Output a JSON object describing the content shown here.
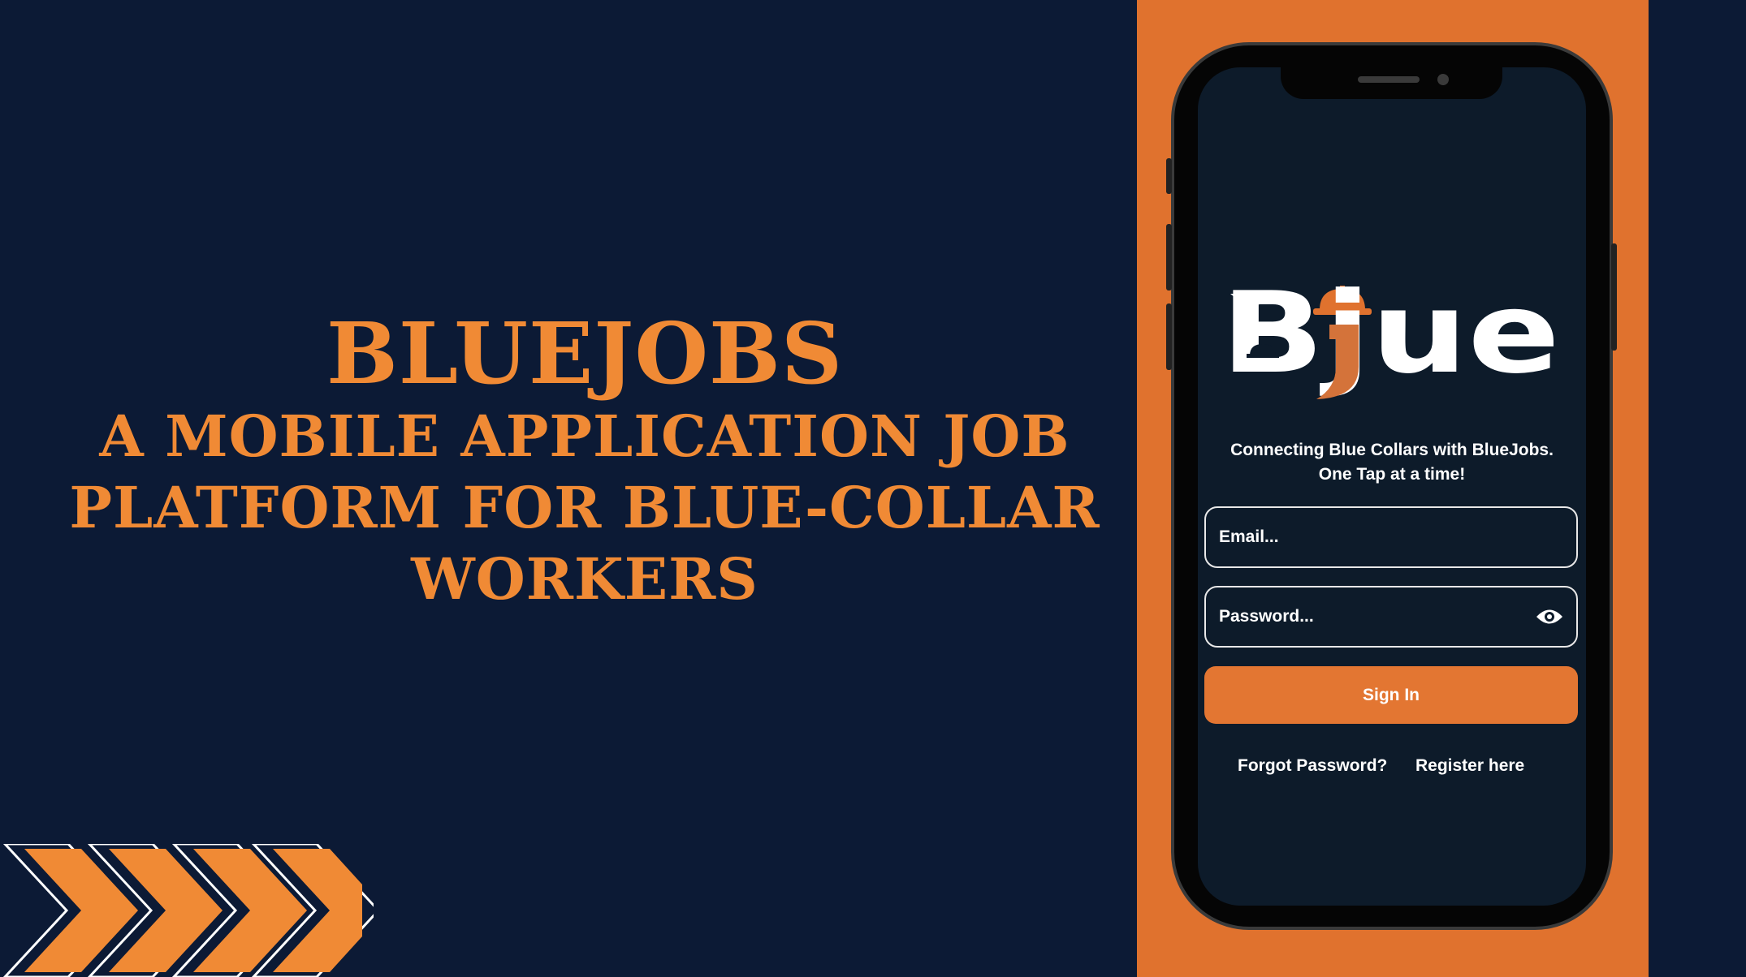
{
  "headline": {
    "title": "BLUEJOBS",
    "subtitle_lines": [
      "A MOBILE APPLICATION JOB",
      "PLATFORM FOR BLUE-COLLAR",
      "WORKERS"
    ]
  },
  "app": {
    "logo_text": "Bjue",
    "tagline_lines": [
      "Connecting Blue Collars with BlueJobs.",
      "One Tap at a time!"
    ],
    "email": {
      "placeholder": "Email..."
    },
    "password": {
      "placeholder": "Password...",
      "icon": "eye-icon"
    },
    "sign_in_label": "Sign In",
    "forgot_password_label": "Forgot Password?",
    "register_label": "Register here"
  },
  "colors": {
    "background": "#0c1a35",
    "accent": "#f08a35",
    "panel": "#e0722e",
    "screen": "#0d1b2a",
    "button": "#e37632"
  }
}
